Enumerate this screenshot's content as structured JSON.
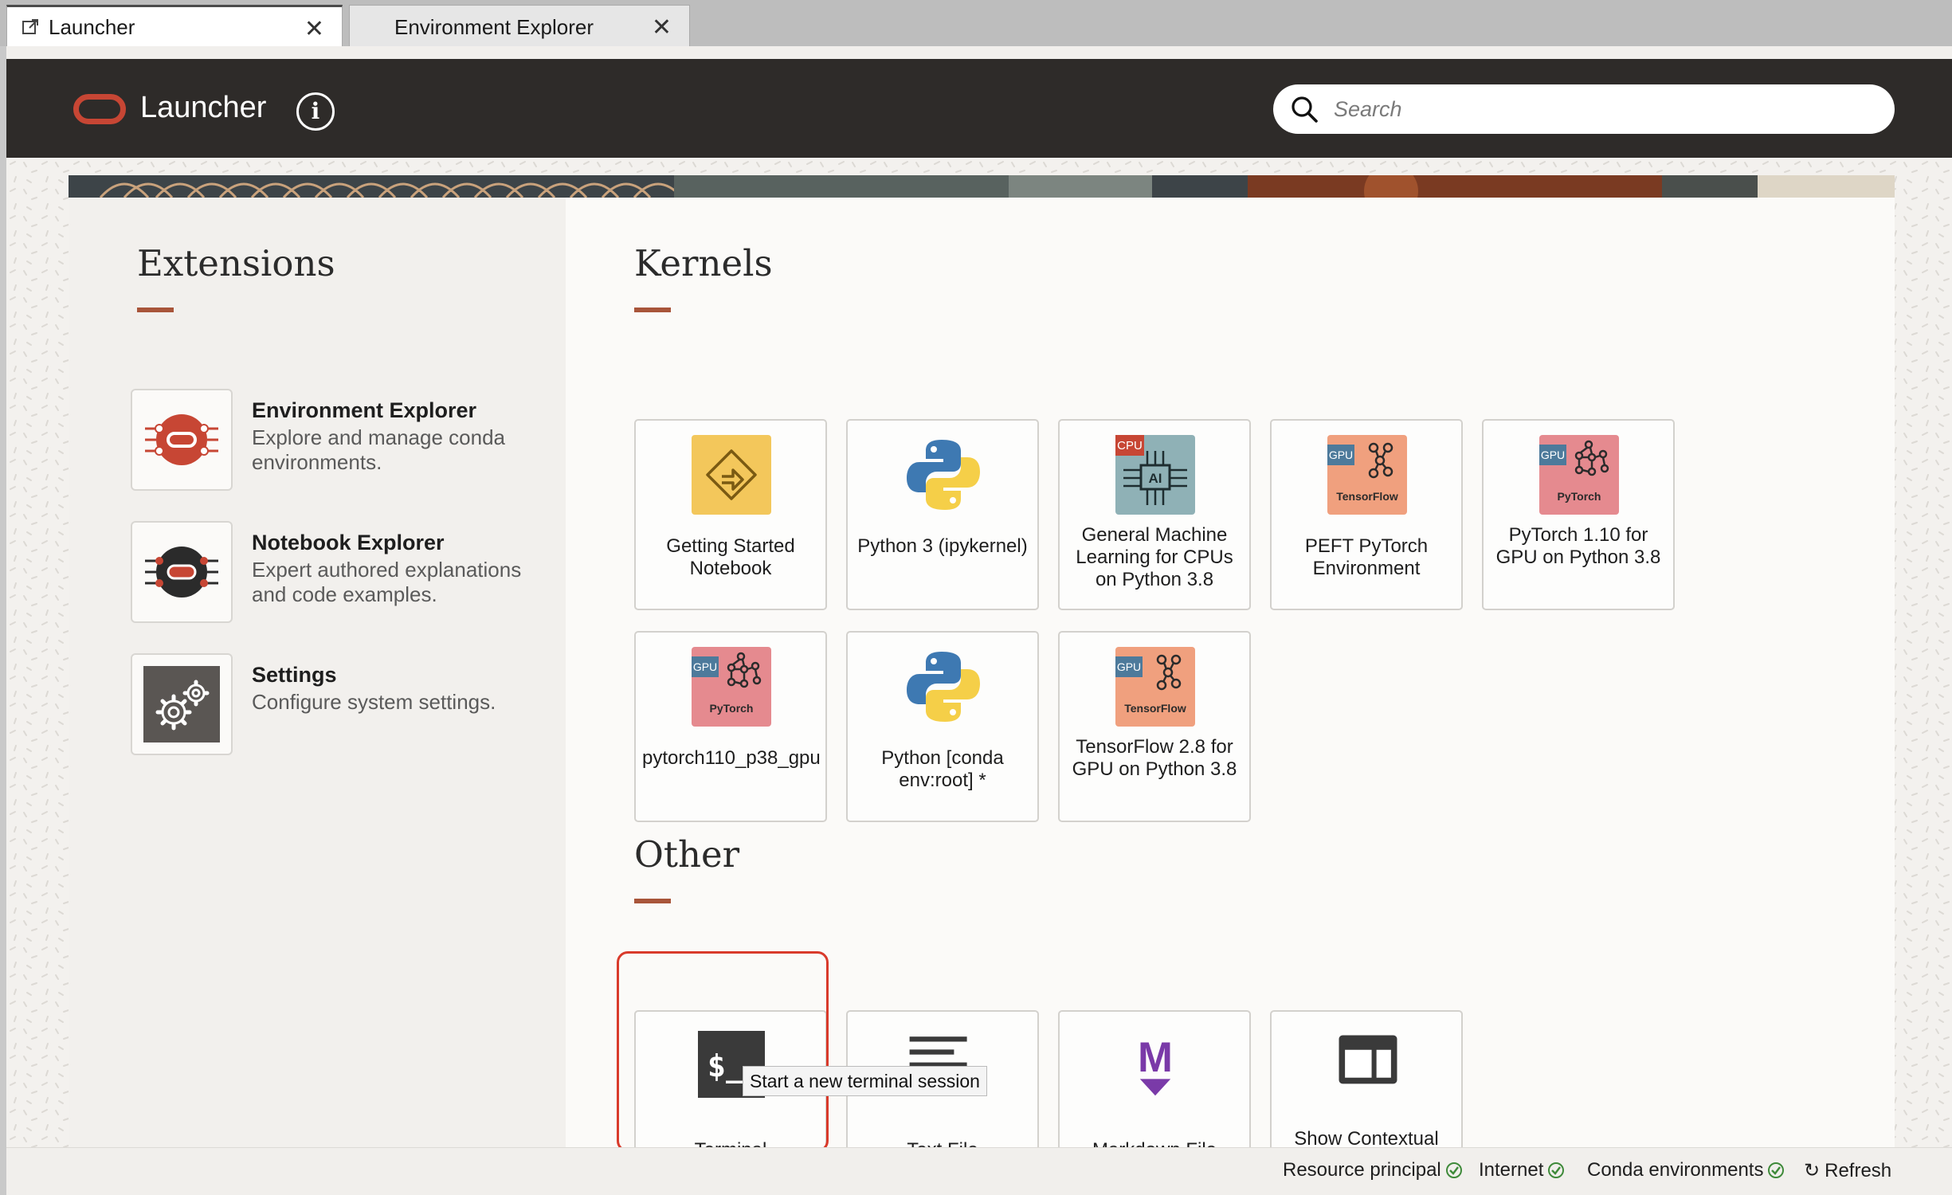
{
  "tabs": [
    {
      "label": "Launcher",
      "close": "✕",
      "active": true
    },
    {
      "label": "Environment Explorer",
      "close": "✕",
      "active": false
    }
  ],
  "header": {
    "title": "Launcher",
    "info_glyph": "i",
    "search_placeholder": "Search"
  },
  "extensions": {
    "title": "Extensions",
    "items": [
      {
        "title": "Environment Explorer",
        "desc": "Explore and manage conda environments.",
        "icon": "environment-explorer-icon"
      },
      {
        "title": "Notebook Explorer",
        "desc": "Expert authored explanations and code examples.",
        "icon": "notebook-explorer-icon"
      },
      {
        "title": "Settings",
        "desc": "Configure system settings.",
        "icon": "gears-icon"
      }
    ]
  },
  "kernels": {
    "title": "Kernels",
    "tiles": [
      {
        "label": "Getting Started Notebook",
        "icon": "getting-started-icon"
      },
      {
        "label": "Python 3 (ipykernel)",
        "icon": "python-icon"
      },
      {
        "label": "General Machine Learning for CPUs on Python 3.8",
        "icon": "cpu-ai-chip-icon",
        "badge": "CPU",
        "chip_text": "AI"
      },
      {
        "label": "PEFT PyTorch Environment",
        "icon": "tensorflow-gpu-icon",
        "badge": "GPU",
        "caption": "TensorFlow"
      },
      {
        "label": "PyTorch 1.10 for GPU on Python 3.8",
        "icon": "pytorch-gpu-icon",
        "badge": "GPU",
        "caption": "PyTorch"
      },
      {
        "label": "pytorch110_p38_gpu",
        "icon": "pytorch-gpu-icon",
        "badge": "GPU",
        "caption": "PyTorch"
      },
      {
        "label": "Python [conda env:root] *",
        "icon": "python-icon"
      },
      {
        "label": "TensorFlow 2.8 for GPU on Python 3.8",
        "icon": "tensorflow-gpu-icon",
        "badge": "GPU",
        "caption": "TensorFlow"
      }
    ]
  },
  "other": {
    "title": "Other",
    "tiles": [
      {
        "label": "Terminal",
        "icon": "terminal-icon",
        "glyph": "$_"
      },
      {
        "label": "Text File",
        "icon": "text-file-icon"
      },
      {
        "label": "Markdown File",
        "icon": "markdown-icon",
        "glyph": "M"
      },
      {
        "label": "Show Contextual Help",
        "icon": "contextual-help-icon"
      }
    ],
    "tooltip": "Start a new terminal session"
  },
  "statusbar": {
    "items": [
      {
        "label": "Resource principal",
        "status": "ok"
      },
      {
        "label": "Internet",
        "status": "ok"
      },
      {
        "label": "Conda environments",
        "status": "ok"
      }
    ],
    "refresh_label": "Refresh",
    "refresh_glyph": "↻"
  },
  "colors": {
    "accent": "#c74634",
    "header_bg": "#2e2b29",
    "rule": "#a8553a",
    "status_ok": "#3f8a3a",
    "highlight": "#d93a2b"
  }
}
